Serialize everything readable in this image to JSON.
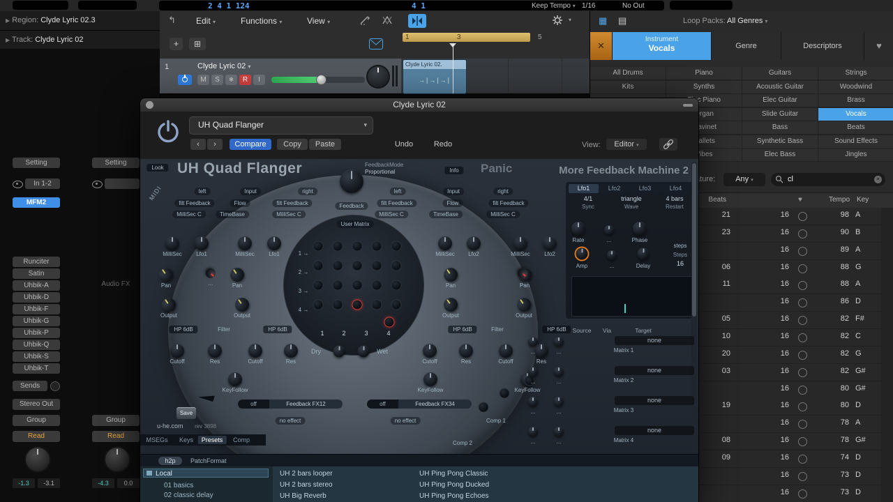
{
  "transport": {
    "lcd_left": "2 4 1 124",
    "lcd_mid": "4 1",
    "keep_tempo": "Keep Tempo",
    "division": "1/16",
    "midi_out": "No Out"
  },
  "inspector": {
    "region_label": "Region:",
    "region_value": "Clyde Lyric 02.3",
    "track_label": "Track:",
    "track_value": "Clyde Lyric 02"
  },
  "toolbar": {
    "menus": [
      "Edit",
      "Functions",
      "View"
    ]
  },
  "ruler": {
    "marks": [
      "1",
      "3",
      "5"
    ]
  },
  "track": {
    "index": "1",
    "name": "Clyde Lyric 02",
    "mute": "M",
    "solo": "S",
    "record": "R",
    "input": "I",
    "region_name": "Clyde Lyric 02.",
    "region_pattern": "→|→|→|"
  },
  "channel_strips": {
    "strip1": {
      "setting": "Setting",
      "input": "In 1-2",
      "insert_selected": "MFM2",
      "inserts": [
        "Runciter",
        "Satin",
        "Uhbik-A",
        "Uhbik-D",
        "Uhbik-F",
        "Uhbik-G",
        "Uhbik-P",
        "Uhbik-Q",
        "Uhbik-S",
        "Uhbik-T"
      ],
      "sends": "Sends",
      "output": "Stereo Out",
      "group": "Group",
      "automation": "Read",
      "value_left": "-1.3",
      "value_right": "-3.1"
    },
    "strip2": {
      "setting": "Setting",
      "audio_fx": "Audio FX",
      "group": "Group",
      "automation": "Read",
      "value_left": "-4.3",
      "value_right": "0.0"
    }
  },
  "loop_browser": {
    "packs_label": "Loop Packs:",
    "packs_value": "All Genres",
    "tabs": {
      "instrument_top": "Instrument",
      "instrument_bottom": "Vocals",
      "genre": "Genre",
      "descriptors": "Descriptors"
    },
    "categories": [
      [
        "All Drums",
        "Piano",
        "Guitars",
        "Strings"
      ],
      [
        "Kits",
        "Synths",
        "Acoustic Guitar",
        "Woodwind"
      ],
      [
        "",
        "Elec Piano",
        "Elec Guitar",
        "Brass"
      ],
      [
        "",
        "Organ",
        "Slide Guitar",
        "Vocals"
      ],
      [
        "",
        "Clavinet",
        "Bass",
        "Beats"
      ],
      [
        "",
        "Mallets",
        "Synthetic Bass",
        "Sound Effects"
      ],
      [
        "",
        "Vibes",
        "Elec Bass",
        "Jingles"
      ]
    ],
    "selected_category": "Vocals",
    "signature_label": "Signature:",
    "signature_value": "Any",
    "search_value": "cl",
    "table": {
      "headers": {
        "beats": "Beats",
        "tempo": "Tempo",
        "key": "Key"
      },
      "rows": [
        [
          "21",
          "16",
          "98",
          "A"
        ],
        [
          "23",
          "16",
          "90",
          "B"
        ],
        [
          "",
          "16",
          "89",
          "A"
        ],
        [
          "06",
          "16",
          "88",
          "G"
        ],
        [
          "11",
          "16",
          "88",
          "A"
        ],
        [
          "",
          "16",
          "86",
          "D"
        ],
        [
          "05",
          "16",
          "82",
          "F#"
        ],
        [
          "10",
          "16",
          "82",
          "C"
        ],
        [
          "20",
          "16",
          "82",
          "G"
        ],
        [
          "03",
          "16",
          "82",
          "G#"
        ],
        [
          "",
          "16",
          "80",
          "G#"
        ],
        [
          "19",
          "16",
          "80",
          "D"
        ],
        [
          "",
          "16",
          "78",
          "A"
        ],
        [
          "08",
          "16",
          "78",
          "G#"
        ],
        [
          "09",
          "16",
          "74",
          "D"
        ],
        [
          "",
          "16",
          "73",
          "D"
        ],
        [
          "",
          "16",
          "73",
          "D"
        ]
      ]
    }
  },
  "plugin_window": {
    "title": "Clyde Lyric 02",
    "preset": "UH Quad Flanger",
    "buttons": {
      "compare": "Compare",
      "copy": "Copy",
      "paste": "Paste",
      "undo": "Undo",
      "redo": "Redo"
    },
    "view_label": "View:",
    "view_value": "Editor"
  },
  "mfm2": {
    "look": "Look",
    "title": "UH Quad Flanger",
    "feedback_mode_label": "FeedbackMode",
    "feedback_mode_value": "Proportional",
    "info": "Info",
    "panic": "Panic",
    "machine_title": "More Feedback Machine 2",
    "midi": "MIDI",
    "feedback": "Feedback",
    "user_matrix": "User Matrix",
    "strip_rows": [
      [
        "left",
        "Input",
        "right"
      ],
      [
        "filt Feedback",
        "Flow",
        "filt Feedback"
      ],
      [
        "MilliSec C",
        "TimeBase",
        "MilliSec C"
      ]
    ],
    "left_knobs": [
      "MilliSec",
      "Lfo1",
      "MilliSec",
      "Lfo1",
      "Pan",
      "Pan",
      "Output",
      "Output",
      "Cutoff",
      "Res",
      "Cutoff",
      "Res",
      "KeyFollow"
    ],
    "right_knobs": [
      "MilliSec",
      "Lfo2",
      "MilliSec",
      "Lfo2",
      "Pan",
      "Pan",
      "Output",
      "Output",
      "Cutoff",
      "Res",
      "Cutoff",
      "Res",
      "KeyFollow",
      "KeyFollow"
    ],
    "filter_row": [
      "HP 6dB",
      "Filter",
      "HP 6dB"
    ],
    "matrix_rows": [
      "1 →",
      "2 →",
      "3 →",
      "4 →"
    ],
    "matrix_cols": [
      "1",
      "2",
      "3",
      "4"
    ],
    "dry": "Dry",
    "wet": "Wet",
    "dots_label": "...",
    "lfo": {
      "tabs": [
        "Lfo1",
        "Lfo2",
        "Lfo3",
        "Lfo4"
      ],
      "selected": "Lfo1",
      "settings": [
        {
          "value": "4/1",
          "label": "Sync"
        },
        {
          "value": "triangle",
          "label": "Wave"
        },
        {
          "value": "4 bars",
          "label": "Restart"
        }
      ],
      "knob1": "Rate",
      "knob2": "Phase",
      "knob3": "Amp",
      "knob4": "...",
      "knob5": "Delay",
      "steps_mode": "steps",
      "steps_label": "Steps",
      "steps_value": "16"
    },
    "mod_matrix": {
      "headers": [
        "Source",
        "Via",
        "Target"
      ],
      "slots": [
        {
          "value": "none",
          "label": "Matrix 1"
        },
        {
          "value": "none",
          "label": "Matrix 2"
        },
        {
          "value": "none",
          "label": "Matrix 3"
        },
        {
          "value": "none",
          "label": "Matrix 4"
        }
      ]
    },
    "comp1": "Comp 1",
    "comp2": "Comp 2",
    "fx_strips": [
      {
        "toggle": "off",
        "name": "Feedback FX12",
        "effect": "no effect"
      },
      {
        "toggle": "off",
        "name": "Feedback FX34",
        "effect": "no effect"
      }
    ],
    "save": "Save",
    "site": "u-he.com",
    "rev": "rev 3898",
    "footer_tabs": [
      "MSEGs",
      "Keys",
      "Presets",
      "Comp"
    ],
    "footer_selected": "Presets",
    "format_button": "h2p",
    "format_label": "PatchFormat",
    "browser": {
      "folders": [
        "Local",
        "01 basics",
        "02 classic delay"
      ],
      "selected_folder": "Local",
      "presets_col1": [
        "UH 2 bars looper",
        "UH 2 bars stereo",
        "UH Big Reverb"
      ],
      "presets_col2": [
        "UH Ping Pong Classic",
        "UH Ping Pong Ducked",
        "UH Ping Pong Echoes"
      ]
    }
  },
  "colors": {
    "accent_blue": "#4aa3e8",
    "compare_blue": "#3069c9",
    "record_red": "#cf4040",
    "read_orange": "#e8a33d",
    "value_teal": "#3fd0c0",
    "loop_bar_tan": "#d0b060",
    "region_blue": "#54809f",
    "panic_grey": "#6a7480"
  }
}
